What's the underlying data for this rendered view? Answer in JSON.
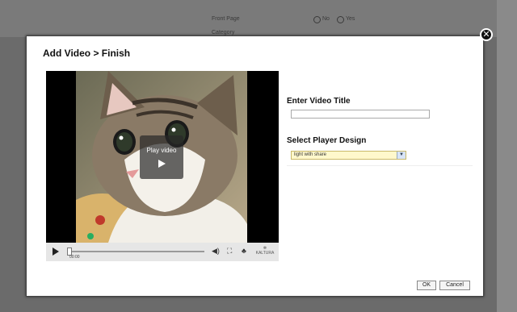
{
  "background": {
    "fields": [
      "Front Page",
      "Category"
    ],
    "radio_no": "No",
    "radio_yes": "Yes"
  },
  "modal": {
    "title": "Add Video > Finish",
    "close_icon": "close-circle-icon"
  },
  "player": {
    "overlay_label": "Play video",
    "time": "00:00",
    "brand": "KALTURA",
    "icons": [
      "play-icon",
      "volume-icon",
      "fullscreen-icon",
      "share-icon",
      "kaltura-logo"
    ]
  },
  "form": {
    "title_label": "Enter Video Title",
    "title_value": "",
    "design_label": "Select Player Design",
    "design_value": "light with share"
  },
  "buttons": {
    "ok": "OK",
    "cancel": "Cancel"
  },
  "colors": {
    "select_bg": "#fff8cc",
    "overlay_bg": "#000000"
  }
}
